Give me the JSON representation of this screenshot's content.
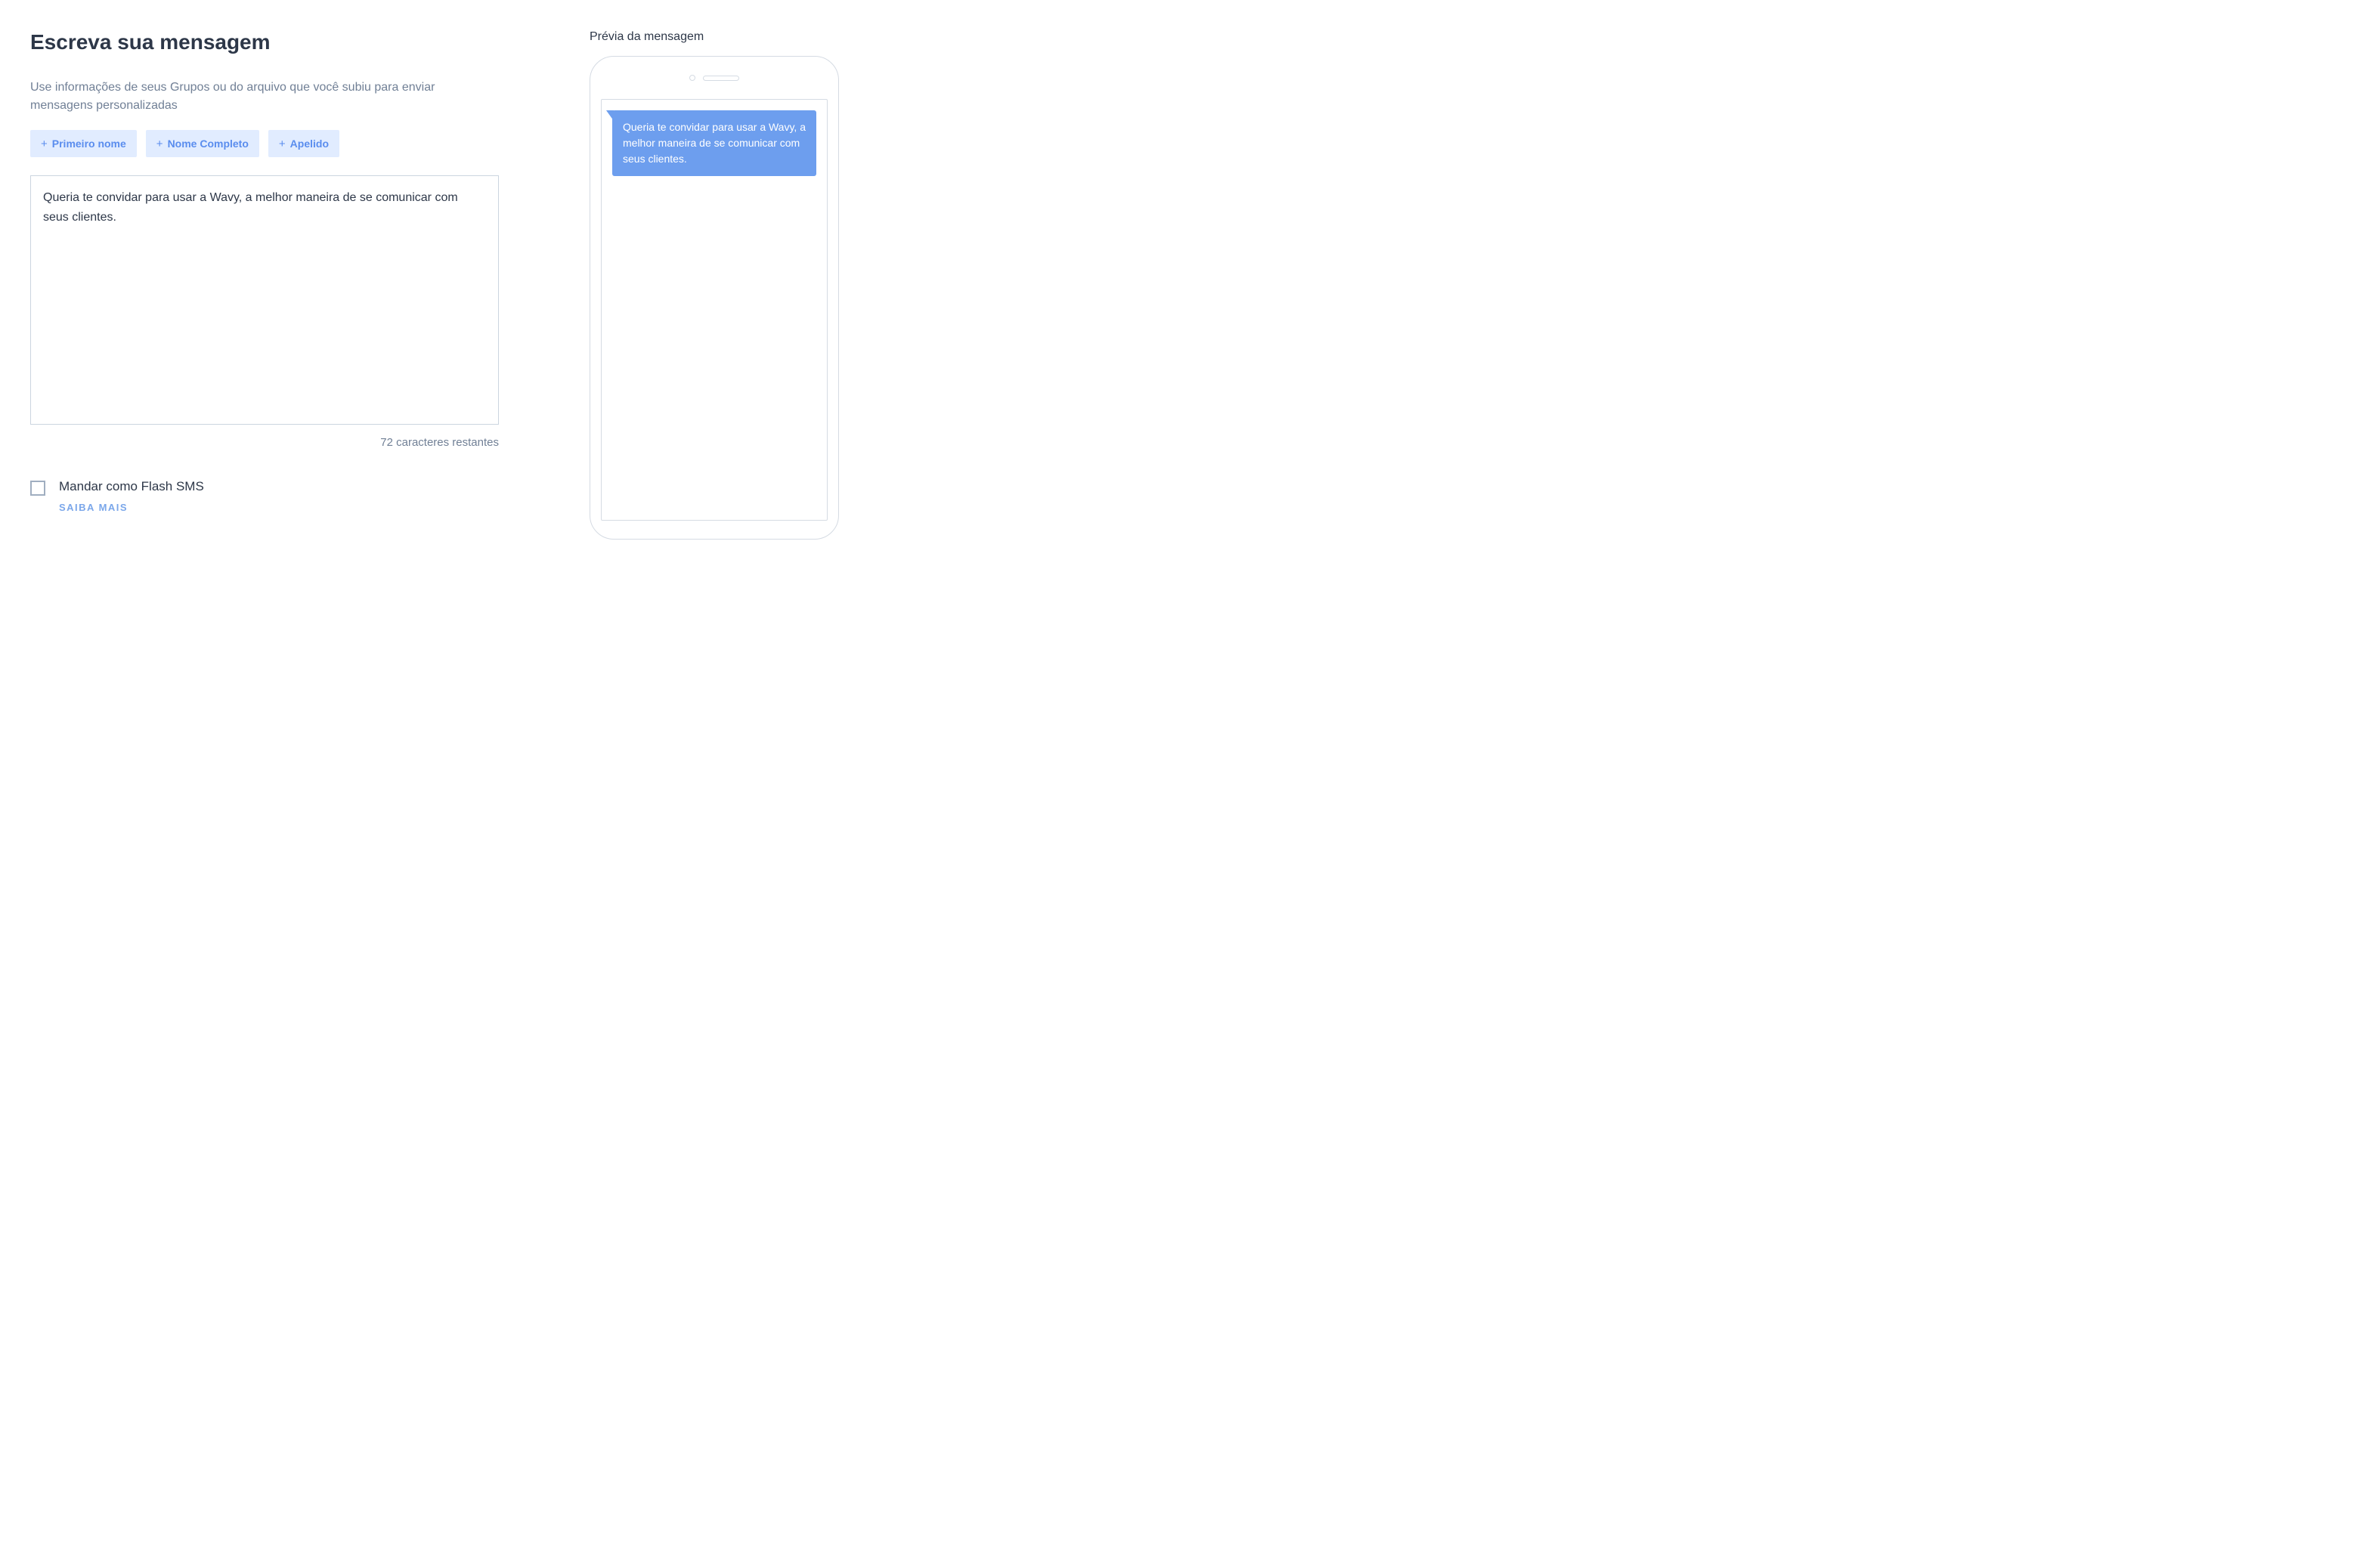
{
  "header": {
    "title": "Escreva sua mensagem",
    "subtitle": "Use informações de seus Grupos ou do arquivo que você subiu para enviar mensagens personalizadas"
  },
  "chips": [
    {
      "label": "Primeiro nome"
    },
    {
      "label": "Nome Completo"
    },
    {
      "label": "Apelido"
    }
  ],
  "editor": {
    "value": "Queria te convidar para usar a Wavy, a melhor maneira de se comunicar com seus clientes.",
    "counter": "72 caracteres restantes"
  },
  "flash_sms": {
    "label": "Mandar como Flash SMS",
    "learn_more": "SAIBA MAIS",
    "checked": false
  },
  "preview": {
    "title": "Prévia da mensagem",
    "bubble_text": "Queria te convidar para usar a Wavy, a melhor maneira de se comunicar com seus clientes."
  }
}
